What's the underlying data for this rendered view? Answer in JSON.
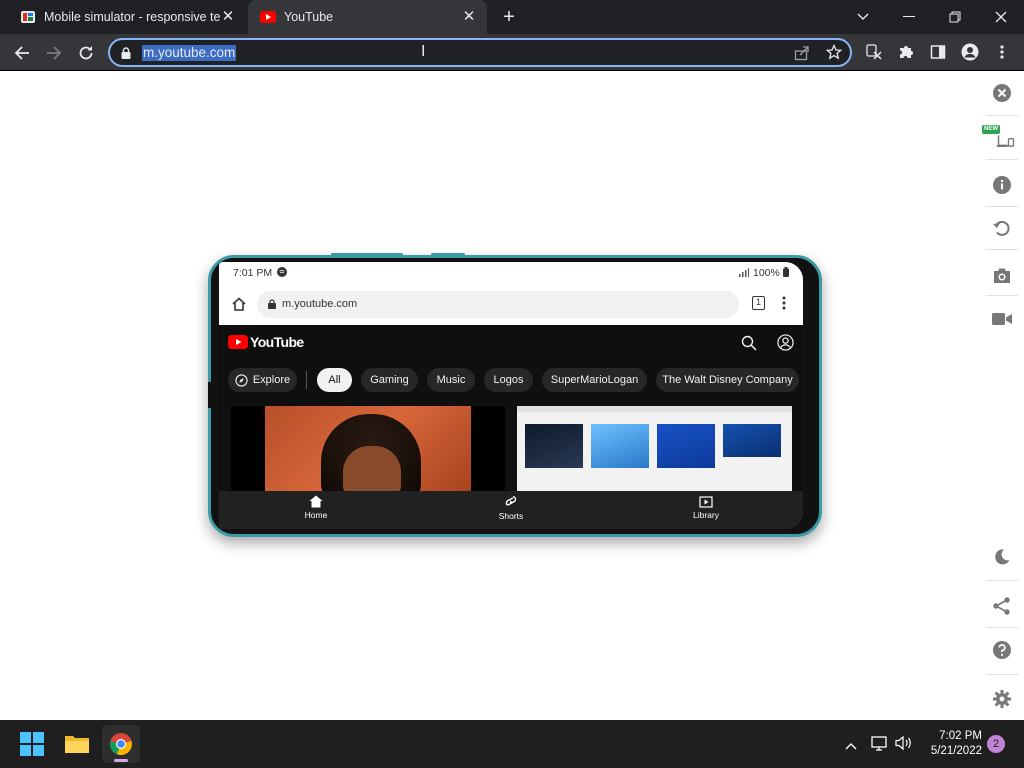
{
  "browser": {
    "tabs": [
      {
        "title": "Mobile simulator - responsive te",
        "favicon": "mobile-simulator-icon",
        "active": false
      },
      {
        "title": "YouTube",
        "favicon": "youtube-icon",
        "active": true
      }
    ],
    "address": "m.youtube.com"
  },
  "phone": {
    "status": {
      "time": "7:01 PM",
      "battery": "100%"
    },
    "url": "m.youtube.com",
    "tab_count": "1",
    "app": {
      "brand": "YouTube",
      "explore_label": "Explore",
      "chips": [
        "All",
        "Gaming",
        "Music",
        "Logos",
        "SuperMarioLogan",
        "The Walt Disney Company"
      ],
      "nav": {
        "home": "Home",
        "shorts": "Shorts",
        "library": "Library"
      }
    }
  },
  "extension_sidebar": {
    "new_badge": "NEW",
    "tools": [
      "close-icon",
      "device-icon",
      "info-icon",
      "rotate-icon",
      "camera-icon",
      "video-icon",
      "dark-mode-icon",
      "share-icon",
      "help-icon",
      "settings-icon"
    ]
  },
  "taskbar": {
    "time": "7:02 PM",
    "date": "5/21/2022",
    "notifications": "2"
  },
  "colors": {
    "youtube_red": "#ff0000",
    "chrome_blue": "#8ab4f8",
    "phone_frame": "#3b9aa4"
  }
}
